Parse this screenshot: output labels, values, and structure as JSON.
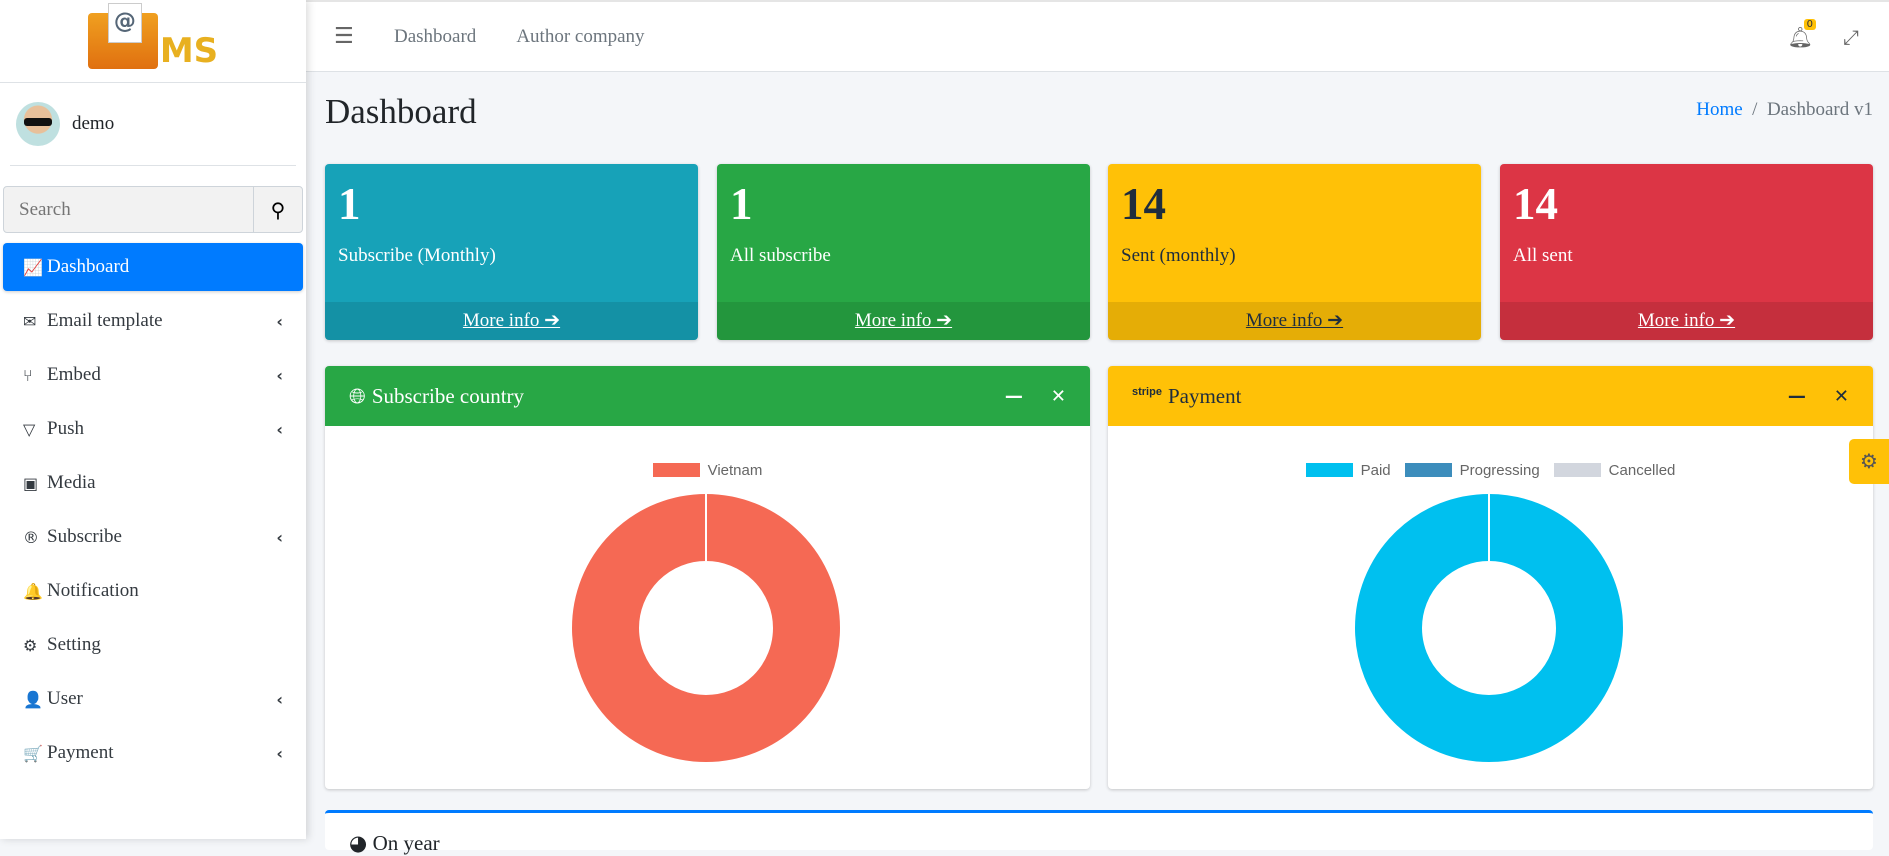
{
  "sidebar": {
    "logo_text": "MS",
    "user": "demo",
    "search_placeholder": "Search",
    "items": [
      {
        "label": "Dashboard",
        "icon": "chart-line-icon",
        "glyph": "📈"
      },
      {
        "label": "Email template",
        "icon": "mail-bulk-icon",
        "glyph": "✉"
      },
      {
        "label": "Embed",
        "icon": "code-branch-icon",
        "glyph": "⑂"
      },
      {
        "label": "Push",
        "icon": "paper-plane-icon",
        "glyph": "▽"
      },
      {
        "label": "Media",
        "icon": "images-icon",
        "glyph": "▣"
      },
      {
        "label": "Subscribe",
        "icon": "registered-icon",
        "glyph": "®"
      },
      {
        "label": "Notification",
        "icon": "bell-icon",
        "glyph": "🔔"
      },
      {
        "label": "Setting",
        "icon": "cogs-icon",
        "glyph": "⚙"
      },
      {
        "label": "User",
        "icon": "user-icon",
        "glyph": "👤"
      },
      {
        "label": "Payment",
        "icon": "cart-icon",
        "glyph": "🛒"
      }
    ]
  },
  "header": {
    "nav": [
      "Dashboard",
      "Author company"
    ],
    "notifications": "0"
  },
  "page": {
    "title": "Dashboard",
    "breadcrumb_home": "Home",
    "breadcrumb_current": "Dashboard v1"
  },
  "stats": [
    {
      "value": "1",
      "label": "Subscribe (Monthly)",
      "more": "More info ➔",
      "color": "#17a2b8"
    },
    {
      "value": "1",
      "label": "All subscribe",
      "more": "More info ➔",
      "color": "#28a745"
    },
    {
      "value": "14",
      "label": "Sent (monthly)",
      "more": "More info ➔",
      "color": "#ffc107"
    },
    {
      "value": "14",
      "label": "All sent",
      "more": "More info ➔",
      "color": "#dc3545"
    }
  ],
  "chart_data": [
    {
      "type": "pie",
      "title": "Subscribe country",
      "labels": [
        "Vietnam"
      ],
      "values": [
        1
      ],
      "colors": [
        "#f56954"
      ]
    },
    {
      "type": "pie",
      "title": "Payment",
      "title_prefix": "stripe",
      "labels": [
        "Paid",
        "Progressing",
        "Cancelled"
      ],
      "values": [
        1,
        0,
        0
      ],
      "colors": [
        "#00c0ef",
        "#3c8dbc",
        "#d2d6de"
      ]
    }
  ],
  "bottom": {
    "title": "On year"
  }
}
